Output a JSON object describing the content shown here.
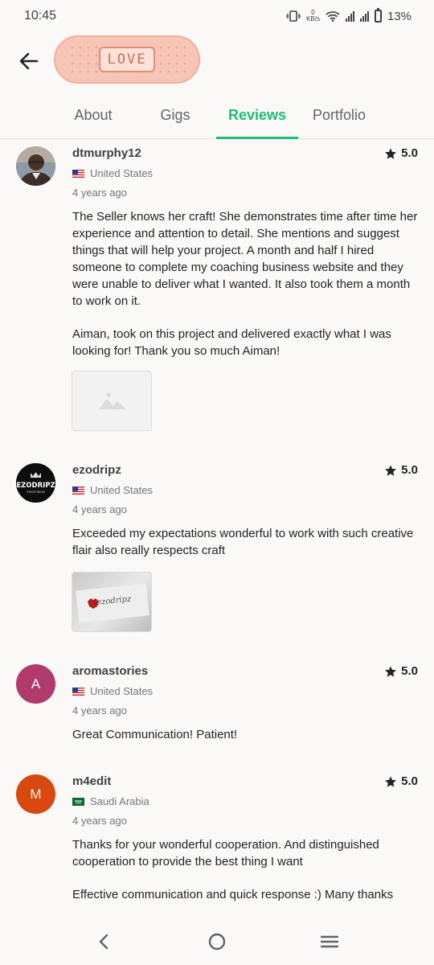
{
  "status_bar": {
    "time": "10:45",
    "network_speed_value": "0",
    "network_speed_unit": "KB/s",
    "battery": "13%"
  },
  "header": {
    "back_icon": "arrow-left-icon",
    "badge_text": "LOVE",
    "badge_color": "#f7c5b5"
  },
  "tabs": [
    {
      "label": "About",
      "active": false
    },
    {
      "label": "Gigs",
      "active": false
    },
    {
      "label": "Reviews",
      "active": true
    },
    {
      "label": "Portfolio",
      "active": false
    }
  ],
  "accent_color": "#1dbf73",
  "reviews": [
    {
      "username": "dtmurphy12",
      "rating": "5.0",
      "country": "United States",
      "time": "4 years ago",
      "paragraphs": [
        "The Seller knows her craft!  She demonstrates time after time her experience and attention to detail.  She mentions and suggest things that will help your project. A month and half I hired someone to complete my coaching business website and they were unable to deliver what I wanted.  It also took them a month to work on it.",
        "Aiman, took on this project and delivered exactly what I was looking for!  Thank you so much Aiman!"
      ],
      "attachment": "image-placeholder-icon"
    },
    {
      "username": "ezodripz",
      "rating": "5.0",
      "country": "United States",
      "time": "4 years ago",
      "paragraphs": [
        "Exceeded my expectations wonderful to work with such creative flair also really respects craft"
      ],
      "avatar_logo_text": "EZODRIPZ",
      "avatar_logo_sub": "STREETWEAR",
      "attachment_logo_text": "ezodripz"
    },
    {
      "username": "aromastories",
      "rating": "5.0",
      "country": "United States",
      "time": "4 years ago",
      "initial": "A",
      "avatar_color": "#b03a6c",
      "paragraphs": [
        "Great Communication! Patient!"
      ]
    },
    {
      "username": "m4edit",
      "rating": "5.0",
      "country": "Saudi Arabia",
      "time": "4 years ago",
      "initial": "M",
      "avatar_color": "#d9480f",
      "paragraphs": [
        "Thanks for your wonderful cooperation. And distinguished cooperation to provide the best thing I want",
        "Effective communication and quick response :) Many thanks"
      ]
    }
  ],
  "nav_bar": {
    "back": "chevron-left-icon",
    "home": "circle-home-icon",
    "recents": "menu-lines-icon"
  }
}
